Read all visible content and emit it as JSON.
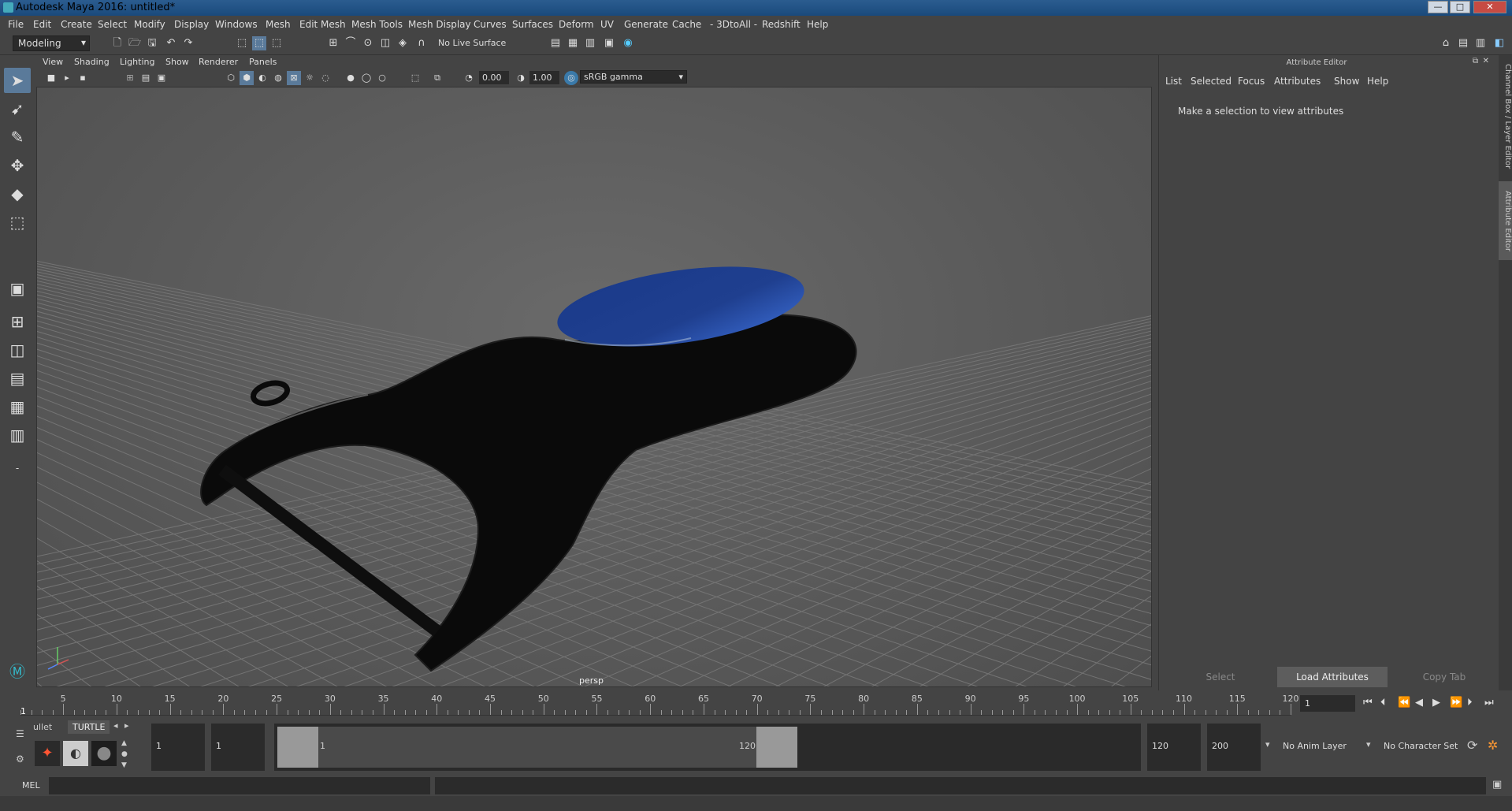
{
  "window": {
    "title": "Autodesk Maya 2016: untitled*",
    "minimize": "—",
    "maximize": "□",
    "close": "✕"
  },
  "menubar": [
    "File",
    "Edit",
    "Create",
    "Select",
    "Modify",
    "Display",
    "Windows",
    "Mesh",
    "Edit Mesh",
    "Mesh Tools",
    "Mesh Display",
    "Curves",
    "Surfaces",
    "Deform",
    "UV",
    "Generate",
    "Cache",
    "- 3DtoAll -",
    "Redshift",
    "Help"
  ],
  "shelf": {
    "mode": "Modeling",
    "live_surface": "No Live Surface"
  },
  "viewport": {
    "menus": [
      "View",
      "Shading",
      "Lighting",
      "Show",
      "Renderer",
      "Panels"
    ],
    "exposure": "0.00",
    "gamma": "1.00",
    "color_space": "sRGB gamma",
    "camera_label": "persp"
  },
  "attribute_editor": {
    "title": "Attribute Editor",
    "menus": [
      "List",
      "Selected",
      "Focus",
      "Attributes",
      "Show",
      "Help"
    ],
    "message": "Make a selection to view attributes",
    "buttons": {
      "select": "Select",
      "load": "Load Attributes",
      "copy": "Copy Tab"
    }
  },
  "side_tabs": {
    "channel_box": "Channel Box / Layer Editor",
    "attribute_editor": "Attribute Editor"
  },
  "timeline": {
    "ticks": [
      "5",
      "10",
      "15",
      "20",
      "25",
      "30",
      "35",
      "40",
      "45",
      "50",
      "55",
      "60",
      "65",
      "70",
      "75",
      "80",
      "85",
      "90",
      "95",
      "100",
      "105",
      "110",
      "115",
      "120"
    ],
    "start_label": "1",
    "current_frame": "1"
  },
  "range": {
    "shelf_tabs": [
      "ullet",
      "TURTLE"
    ],
    "start_time": "1",
    "playback_start": "1",
    "range_start": "1",
    "range_end": "120",
    "playback_end": "120",
    "end_time": "200",
    "anim_layer": "No Anim Layer",
    "character_set": "No Character Set"
  },
  "cmdline": {
    "lang": "MEL"
  },
  "colors": {
    "accent": "#5a7a9a",
    "title_bar": "#2b5c8f",
    "lens_blue": "#1f3f8f"
  }
}
